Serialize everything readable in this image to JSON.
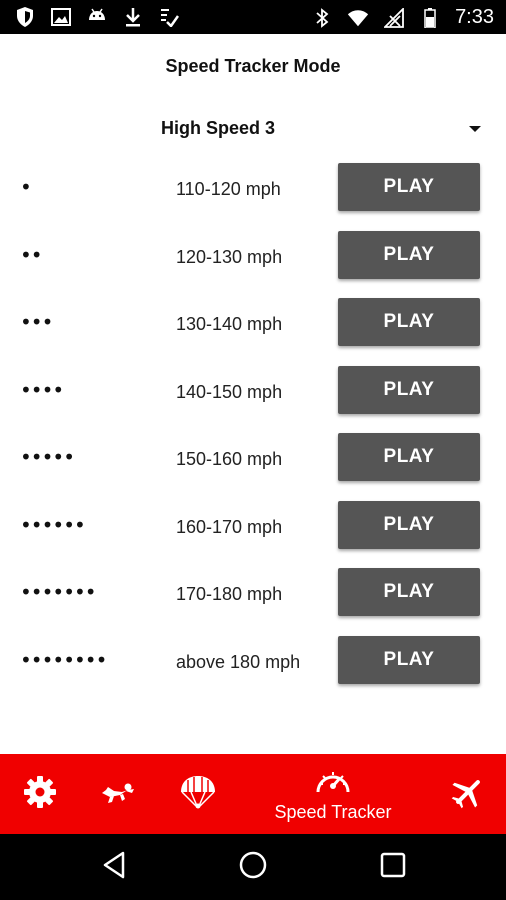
{
  "status_bar": {
    "time": "7:33",
    "left_icons": [
      "shield-icon",
      "image-icon",
      "android-icon",
      "download-icon",
      "checklist-icon"
    ],
    "right_icons": [
      "bluetooth-icon",
      "wifi-icon",
      "no-signal-icon",
      "battery-icon"
    ]
  },
  "page": {
    "title": "Speed Tracker Mode"
  },
  "mode_select": {
    "selected": "High Speed 3"
  },
  "tones": [
    {
      "dots": "•",
      "range": "110-120 mph",
      "button": "PLAY"
    },
    {
      "dots": "••",
      "range": "120-130 mph",
      "button": "PLAY"
    },
    {
      "dots": "•••",
      "range": "130-140 mph",
      "button": "PLAY"
    },
    {
      "dots": "••••",
      "range": "140-150 mph",
      "button": "PLAY"
    },
    {
      "dots": "•••••",
      "range": "150-160 mph",
      "button": "PLAY"
    },
    {
      "dots": "••••••",
      "range": "160-170 mph",
      "button": "PLAY"
    },
    {
      "dots": "•••••••",
      "range": "170-180 mph",
      "button": "PLAY"
    },
    {
      "dots": "••••••••",
      "range": "above 180 mph",
      "button": "PLAY"
    }
  ],
  "tab_bar": {
    "accent": "#f00000",
    "tabs": [
      {
        "icon": "gear-icon",
        "label": ""
      },
      {
        "icon": "skydiver-icon",
        "label": ""
      },
      {
        "icon": "parachute-icon",
        "label": ""
      },
      {
        "icon": "speedometer-icon",
        "label": "Speed Tracker",
        "active": true
      },
      {
        "icon": "airplane-icon",
        "label": ""
      }
    ]
  },
  "nav_bar": {
    "buttons": [
      "back-icon",
      "home-icon",
      "recents-icon"
    ]
  }
}
